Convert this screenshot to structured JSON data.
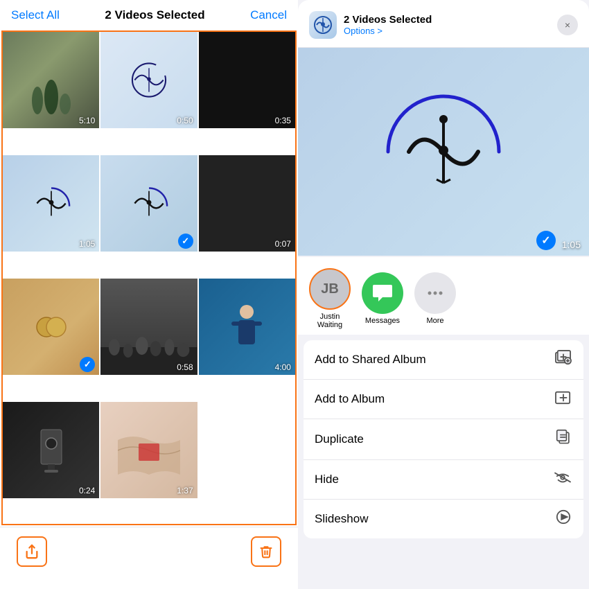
{
  "left": {
    "select_all": "Select All",
    "title": "2 Videos Selected",
    "cancel": "Cancel",
    "cells": [
      {
        "id": 1,
        "duration": "5:10",
        "selected": false,
        "type": "scene"
      },
      {
        "id": 2,
        "duration": "0:50",
        "selected": false,
        "type": "logo"
      },
      {
        "id": 3,
        "duration": "0:35",
        "selected": false,
        "type": "dark"
      },
      {
        "id": 4,
        "duration": "1:05",
        "selected": false,
        "type": "logo"
      },
      {
        "id": 5,
        "duration": "",
        "selected": true,
        "type": "logo"
      },
      {
        "id": 6,
        "duration": "0:07",
        "selected": false,
        "type": "dark"
      },
      {
        "id": 7,
        "duration": "",
        "selected": true,
        "type": "coins"
      },
      {
        "id": 8,
        "duration": "0:58",
        "selected": false,
        "type": "crowd"
      },
      {
        "id": 9,
        "duration": "4:00",
        "selected": false,
        "type": "speaker"
      },
      {
        "id": 10,
        "duration": "0:24",
        "selected": false,
        "type": "dark2"
      },
      {
        "id": 11,
        "duration": "1:37",
        "selected": false,
        "type": "fabric"
      }
    ],
    "share_icon": "↥",
    "trash_icon": "🗑"
  },
  "right": {
    "sheet": {
      "app_icon_letter": "⊕",
      "title": "2 Videos Selected",
      "subtitle": "Options >",
      "close": "×",
      "preview_duration": "1:05",
      "contacts": [
        {
          "initials": "JB",
          "name": "Justin\nWaiting"
        }
      ],
      "apps": [
        {
          "name": "Messages",
          "label": "Messages"
        },
        {
          "name": "More",
          "label": "More"
        }
      ],
      "actions": [
        {
          "label": "Add to Shared Album",
          "icon": "shared-album-icon"
        },
        {
          "label": "Add to Album",
          "icon": "add-album-icon"
        },
        {
          "label": "Duplicate",
          "icon": "duplicate-icon"
        },
        {
          "label": "Hide",
          "icon": "hide-icon"
        },
        {
          "label": "Slideshow",
          "icon": "slideshow-icon"
        }
      ]
    }
  }
}
